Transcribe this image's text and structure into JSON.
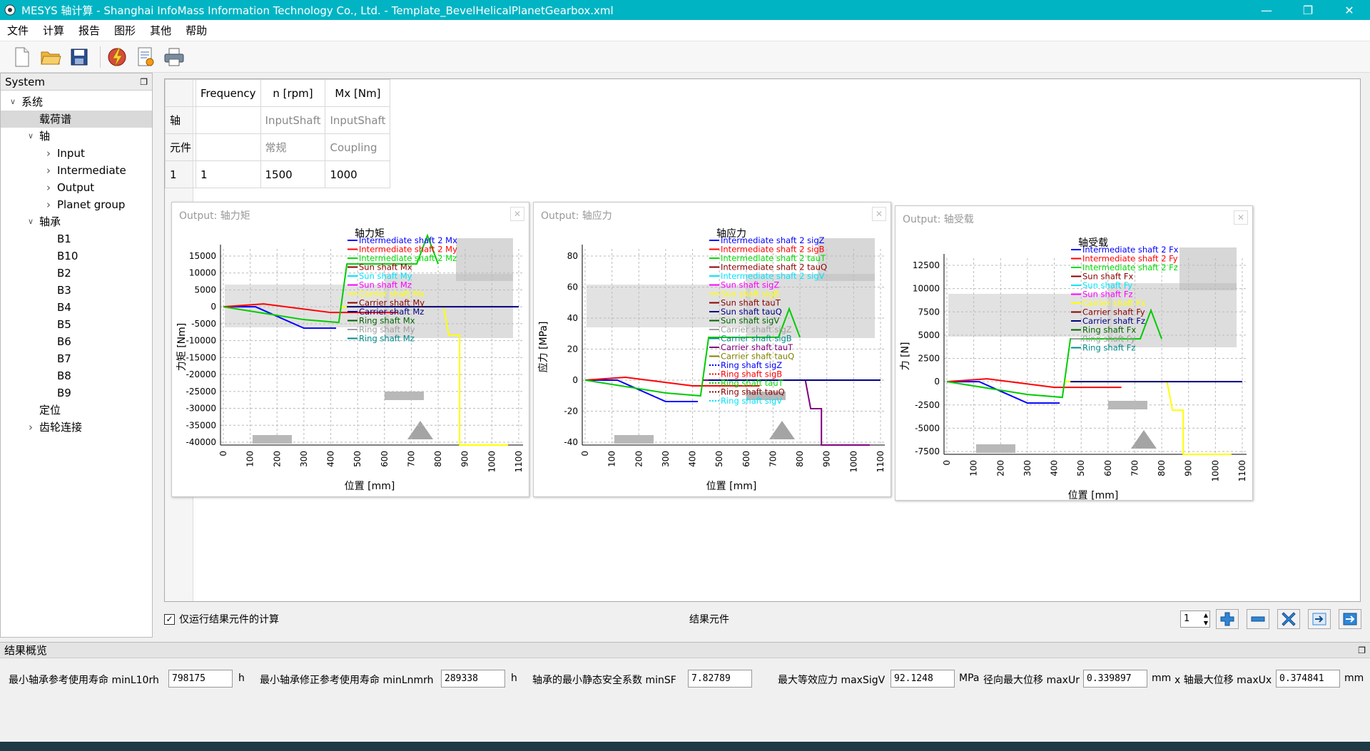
{
  "window": {
    "title": "MESYS 轴计算 - Shanghai InfoMass Information Technology Co., Ltd. - Template_BevelHelicalPlanetGearbox.xml"
  },
  "menu": [
    "文件",
    "计算",
    "报告",
    "图形",
    "其他",
    "帮助"
  ],
  "tree": {
    "header": "System",
    "items": [
      {
        "label": "系统",
        "level": 0,
        "arrow": "open",
        "selected": false
      },
      {
        "label": "载荷谱",
        "level": 1,
        "arrow": "",
        "selected": true
      },
      {
        "label": "轴",
        "level": 1,
        "arrow": "open",
        "selected": false
      },
      {
        "label": "Input",
        "level": 2,
        "arrow": "closed",
        "selected": false
      },
      {
        "label": "Intermediate",
        "level": 2,
        "arrow": "closed",
        "selected": false
      },
      {
        "label": "Output",
        "level": 2,
        "arrow": "closed",
        "selected": false
      },
      {
        "label": "Planet group",
        "level": 2,
        "arrow": "closed",
        "selected": false
      },
      {
        "label": "轴承",
        "level": 1,
        "arrow": "open",
        "selected": false
      },
      {
        "label": "B1",
        "level": 2,
        "arrow": "",
        "selected": false
      },
      {
        "label": "B10",
        "level": 2,
        "arrow": "",
        "selected": false
      },
      {
        "label": "B2",
        "level": 2,
        "arrow": "",
        "selected": false
      },
      {
        "label": "B3",
        "level": 2,
        "arrow": "",
        "selected": false
      },
      {
        "label": "B4",
        "level": 2,
        "arrow": "",
        "selected": false
      },
      {
        "label": "B5",
        "level": 2,
        "arrow": "",
        "selected": false
      },
      {
        "label": "B6",
        "level": 2,
        "arrow": "",
        "selected": false
      },
      {
        "label": "B7",
        "level": 2,
        "arrow": "",
        "selected": false
      },
      {
        "label": "B8",
        "level": 2,
        "arrow": "",
        "selected": false
      },
      {
        "label": "B9",
        "level": 2,
        "arrow": "",
        "selected": false
      },
      {
        "label": "定位",
        "level": 1,
        "arrow": "",
        "selected": false
      },
      {
        "label": "齿轮连接",
        "level": 1,
        "arrow": "closed",
        "selected": false
      }
    ]
  },
  "load_table": {
    "header": [
      "",
      "Frequency",
      "n [rpm]",
      "Mx [Nm]"
    ],
    "row_shaft": [
      "轴",
      "",
      "InputShaft",
      "InputShaft"
    ],
    "row_element": [
      "元件",
      "",
      "常规",
      "Coupling"
    ],
    "rows": [
      [
        "1",
        "1",
        "1500",
        "1000"
      ]
    ]
  },
  "charts": [
    {
      "window_title": "Output: 轴力矩",
      "title": "轴力矩",
      "ylabel": "力矩 [Nm]",
      "xlabel": "位置 [mm]",
      "yticks": [
        15000,
        10000,
        5000,
        0,
        -5000,
        -10000,
        -15000,
        -20000,
        -25000,
        -30000,
        -35000,
        -40000
      ],
      "xticks": [
        0,
        100,
        200,
        300,
        400,
        500,
        600,
        700,
        800,
        900,
        1000,
        1100
      ],
      "legend": [
        {
          "name": "Intermediate shaft 2 Mx",
          "color": "#0000ff",
          "dash": false
        },
        {
          "name": "Intermediate shaft 2 My",
          "color": "#ff0000",
          "dash": false
        },
        {
          "name": "Intermediate shaft 2 Mz",
          "color": "#00dd00",
          "dash": false
        },
        {
          "name": "Sun shaft Mx",
          "color": "#8b0000",
          "dash": false
        },
        {
          "name": "Sun shaft My",
          "color": "#00e5ff",
          "dash": false
        },
        {
          "name": "Sun shaft Mz",
          "color": "#ff00ff",
          "dash": false
        },
        {
          "name": "Carrier shaft Mx",
          "color": "#ffff00",
          "dash": false
        },
        {
          "name": "Carrier shaft My",
          "color": "#8b0000",
          "dash": false
        },
        {
          "name": "Carrier shaft Mz",
          "color": "#000080",
          "dash": false
        },
        {
          "name": "Ring shaft Mx",
          "color": "#006400",
          "dash": false
        },
        {
          "name": "Ring shaft My",
          "color": "#a0a0a0",
          "dash": false
        },
        {
          "name": "Ring shaft Mz",
          "color": "#008b8b",
          "dash": false
        }
      ]
    },
    {
      "window_title": "Output: 轴应力",
      "title": "轴应力",
      "ylabel": "应力 [MPa]",
      "xlabel": "位置 [mm]",
      "yticks": [
        80,
        60,
        40,
        20,
        0,
        -20,
        -40
      ],
      "xticks": [
        0,
        100,
        200,
        300,
        400,
        500,
        600,
        700,
        800,
        900,
        1000,
        1100
      ],
      "legend": [
        {
          "name": "Intermediate shaft 2 sigZ",
          "color": "#0000ff",
          "dash": false
        },
        {
          "name": "Intermediate shaft 2 sigB",
          "color": "#ff0000",
          "dash": false
        },
        {
          "name": "Intermediate shaft 2 tauT",
          "color": "#00dd00",
          "dash": false
        },
        {
          "name": "Intermediate shaft 2 tauQ",
          "color": "#8b0000",
          "dash": false
        },
        {
          "name": "Intermediate shaft 2 sigV",
          "color": "#00e5ff",
          "dash": false
        },
        {
          "name": "Sun shaft sigZ",
          "color": "#ff00ff",
          "dash": false
        },
        {
          "name": "Sun shaft sigB",
          "color": "#ffff00",
          "dash": false
        },
        {
          "name": "Sun shaft tauT",
          "color": "#8b0000",
          "dash": false
        },
        {
          "name": "Sun shaft tauQ",
          "color": "#000080",
          "dash": false
        },
        {
          "name": "Sun shaft sigV",
          "color": "#006400",
          "dash": false
        },
        {
          "name": "Carrier shaft sigZ",
          "color": "#a0a0a0",
          "dash": false
        },
        {
          "name": "Carrier shaft sigB",
          "color": "#008b8b",
          "dash": false
        },
        {
          "name": "Carrier shaft tauT",
          "color": "#800080",
          "dash": false
        },
        {
          "name": "Carrier shaft tauQ",
          "color": "#808000",
          "dash": false
        },
        {
          "name": "Ring shaft sigZ",
          "color": "#0000ff",
          "dash": true
        },
        {
          "name": "Ring shaft sigB",
          "color": "#ff0000",
          "dash": true
        },
        {
          "name": "Ring shaft tauT",
          "color": "#00dd00",
          "dash": true
        },
        {
          "name": "Ring shaft tauQ",
          "color": "#8b0000",
          "dash": true
        },
        {
          "name": "Ring shaft sigV",
          "color": "#00e5ff",
          "dash": true
        }
      ]
    },
    {
      "window_title": "Output: 轴受载",
      "title": "轴受载",
      "ylabel": "力 [N]",
      "xlabel": "位置 [mm]",
      "yticks": [
        12500,
        10000,
        7500,
        5000,
        2500,
        0,
        -2500,
        -5000,
        -7500
      ],
      "xticks": [
        0,
        100,
        200,
        300,
        400,
        500,
        600,
        700,
        800,
        900,
        1000,
        1100
      ],
      "legend": [
        {
          "name": "Intermediate shaft 2 Fx",
          "color": "#0000ff",
          "dash": false
        },
        {
          "name": "Intermediate shaft 2 Fy",
          "color": "#ff0000",
          "dash": false
        },
        {
          "name": "Intermediate shaft 2 Fz",
          "color": "#00dd00",
          "dash": false
        },
        {
          "name": "Sun shaft Fx",
          "color": "#8b0000",
          "dash": false
        },
        {
          "name": "Sun shaft Fy",
          "color": "#00e5ff",
          "dash": false
        },
        {
          "name": "Sun shaft Fz",
          "color": "#ff00ff",
          "dash": false
        },
        {
          "name": "Carrier shaft Fx",
          "color": "#ffff00",
          "dash": false
        },
        {
          "name": "Carrier shaft Fy",
          "color": "#8b0000",
          "dash": false
        },
        {
          "name": "Carrier shaft Fz",
          "color": "#000080",
          "dash": false
        },
        {
          "name": "Ring shaft Fx",
          "color": "#006400",
          "dash": false
        },
        {
          "name": "Ring shaft Fy",
          "color": "#a0a0a0",
          "dash": false
        },
        {
          "name": "Ring shaft Fz",
          "color": "#008b8b",
          "dash": false
        }
      ]
    }
  ],
  "bottom": {
    "checkbox_label": "仅运行结果元件的计算",
    "center_label": "结果元件",
    "spin_value": "1"
  },
  "results": {
    "header": "结果概览",
    "items": [
      {
        "label": "最小轴承参考使用寿命 minL10rh",
        "value": "798175",
        "unit": "h"
      },
      {
        "label": "最小轴承修正参考使用寿命 minLnmrh",
        "value": "289338",
        "unit": "h"
      },
      {
        "label": "轴承的最小静态安全系数 minSF",
        "value": "7.82789",
        "unit": ""
      },
      {
        "label": "最大等效应力 maxSigV",
        "value": "92.1248",
        "unit": "MPa"
      },
      {
        "label": "径向最大位移 maxUr",
        "value": "0.339897",
        "unit": "mm"
      },
      {
        "label": "x 轴最大位移 maxUx",
        "value": "0.374841",
        "unit": "mm"
      }
    ]
  }
}
